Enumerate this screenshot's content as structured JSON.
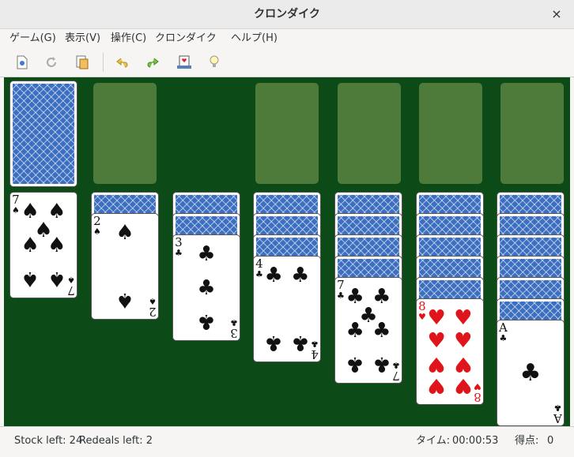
{
  "window": {
    "title": "クロンダイク",
    "close_glyph": "×"
  },
  "menubar": {
    "items": [
      "ゲーム(G)",
      "表示(V)",
      "操作(C)",
      "クロンダイク",
      "ヘルプ(H)"
    ]
  },
  "toolbar": {
    "icons": [
      "new-game-icon",
      "restart-icon",
      "select-game-icon",
      "undo-icon",
      "redo-icon",
      "deal-icon",
      "hint-icon"
    ]
  },
  "game": {
    "stock": {
      "face_down_count": 1
    },
    "foundations_empty": 4,
    "tableau": [
      {
        "down": 0,
        "up": [
          {
            "rank": "7",
            "suit": "♠",
            "color": "black"
          }
        ]
      },
      {
        "down": 1,
        "up": [
          {
            "rank": "2",
            "suit": "♠",
            "color": "black"
          }
        ]
      },
      {
        "down": 2,
        "up": [
          {
            "rank": "3",
            "suit": "♣",
            "color": "black"
          }
        ]
      },
      {
        "down": 3,
        "up": [
          {
            "rank": "4",
            "suit": "♣",
            "color": "black"
          }
        ]
      },
      {
        "down": 4,
        "up": [
          {
            "rank": "7",
            "suit": "♣",
            "color": "black"
          }
        ]
      },
      {
        "down": 5,
        "up": [
          {
            "rank": "8",
            "suit": "♥",
            "color": "red"
          }
        ]
      },
      {
        "down": 6,
        "up": [
          {
            "rank": "A",
            "suit": "♣",
            "color": "black"
          }
        ]
      }
    ]
  },
  "status": {
    "stock_left": "Stock left: 24",
    "redeals_left": "Redeals left: 2",
    "time_label": "タイム:",
    "time_value": "00:00:53",
    "score_label": "得点:",
    "score_value": "0"
  }
}
